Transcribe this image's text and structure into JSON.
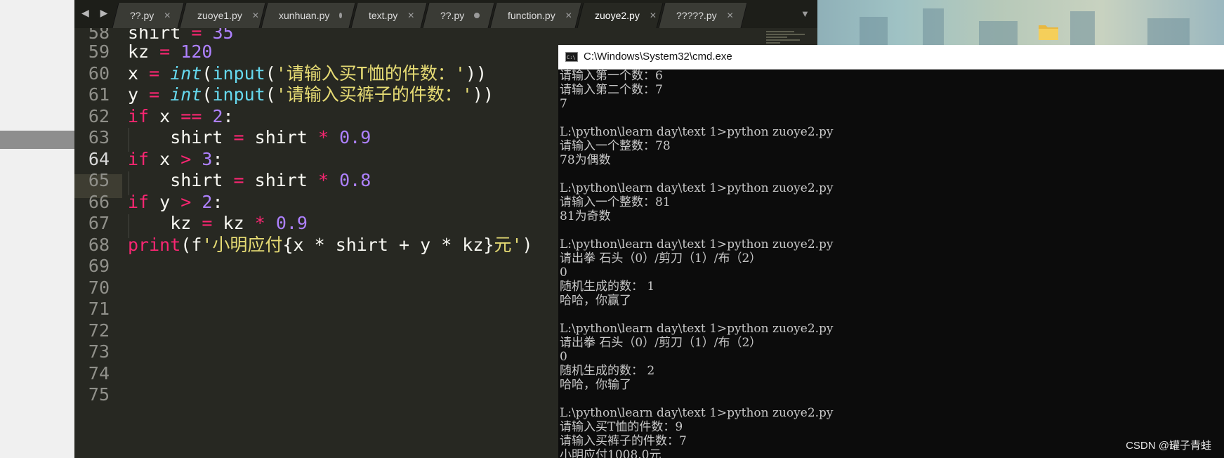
{
  "editor": {
    "nav_arrows": "◀ ▶",
    "tabs": [
      {
        "label": "??.py",
        "state": "close"
      },
      {
        "label": "zuoye1.py",
        "state": "close"
      },
      {
        "label": "xunhuan.py",
        "state": "dirty"
      },
      {
        "label": "text.py",
        "state": "close"
      },
      {
        "label": "??.py",
        "state": "dirty"
      },
      {
        "label": "function.py",
        "state": "close"
      },
      {
        "label": "zuoye2.py",
        "state": "close",
        "active": true
      },
      {
        "label": "?????.py",
        "state": "close"
      }
    ],
    "tab_close_glyph": "✕",
    "overflow_glyph": "▼",
    "line_numbers": [
      "58",
      "59",
      "60",
      "61",
      "62",
      "63",
      "64",
      "65",
      "66",
      "67",
      "68",
      "69",
      "70",
      "71",
      "72",
      "73",
      "74",
      "75"
    ],
    "current_line": "64",
    "code": {
      "l58": {
        "a": "shirt",
        "b": "=",
        "c": "35"
      },
      "l59": {
        "a": "kz",
        "b": "=",
        "c": "120"
      },
      "l60": {
        "a": "x",
        "b": "=",
        "c": "int",
        "d": "(",
        "e": "input",
        "f": "(",
        "g": "'请输入买T恤的件数：'",
        "h": "))"
      },
      "l61": {
        "a": "y",
        "b": "=",
        "c": "int",
        "d": "(",
        "e": "input",
        "f": "(",
        "g": "'请输入买裤子的件数：'",
        "h": "))"
      },
      "l62": {
        "a": "if",
        "b": "x",
        "c": "==",
        "d": "2",
        "e": ":"
      },
      "l63": {
        "a": "shirt",
        "b": "=",
        "c": "shirt",
        "d": "*",
        "e": "0.9"
      },
      "l64": {
        "a": "if",
        "b": "x",
        "c": ">",
        "d": "3",
        "e": ":"
      },
      "l65": {
        "a": "shirt",
        "b": "=",
        "c": "shirt",
        "d": "*",
        "e": "0.8"
      },
      "l66": {
        "a": "if",
        "b": "y",
        "c": ">",
        "d": "2",
        "e": ":"
      },
      "l67": {
        "a": "kz",
        "b": "=",
        "c": "kz",
        "d": "*",
        "e": "0.9"
      },
      "l68": {
        "a": "print",
        "b": "(f",
        "c": "'小明应付",
        "d": "{x * shirt + y * kz}",
        "e": "元'",
        "f": ")"
      }
    }
  },
  "cmd": {
    "title": "C:\\Windows\\System32\\cmd.exe",
    "icon_text": "C:\\",
    "lines": [
      "请输入第一个数：6",
      "请输入第二个数：7",
      "7",
      "",
      "L:\\python\\learn day\\text 1>python zuoye2.py",
      "请输入一个整数：78",
      "78为偶数",
      "",
      "L:\\python\\learn day\\text 1>python zuoye2.py",
      "请输入一个整数：81",
      "81为奇数",
      "",
      "L:\\python\\learn day\\text 1>python zuoye2.py",
      "请出拳 石头（0）/剪刀（1）/布（2）",
      "0",
      "随机生成的数： 1",
      "哈哈，你赢了",
      "",
      "L:\\python\\learn day\\text 1>python zuoye2.py",
      "请出拳 石头（0）/剪刀（1）/布（2）",
      "0",
      "随机生成的数： 2",
      "哈哈，你输了",
      "",
      "L:\\python\\learn day\\text 1>python zuoye2.py",
      "请输入买T恤的件数：9",
      "请输入买裤子的件数：7",
      "小明应付1008.0元"
    ]
  },
  "watermark": "CSDN @罐子青蛙",
  "colors": {
    "editor_bg": "#272822",
    "keyword": "#f92672",
    "number": "#ae81ff",
    "builtin": "#66d9ef",
    "string": "#e6db74",
    "cmd_bg": "#0c0c0c"
  }
}
